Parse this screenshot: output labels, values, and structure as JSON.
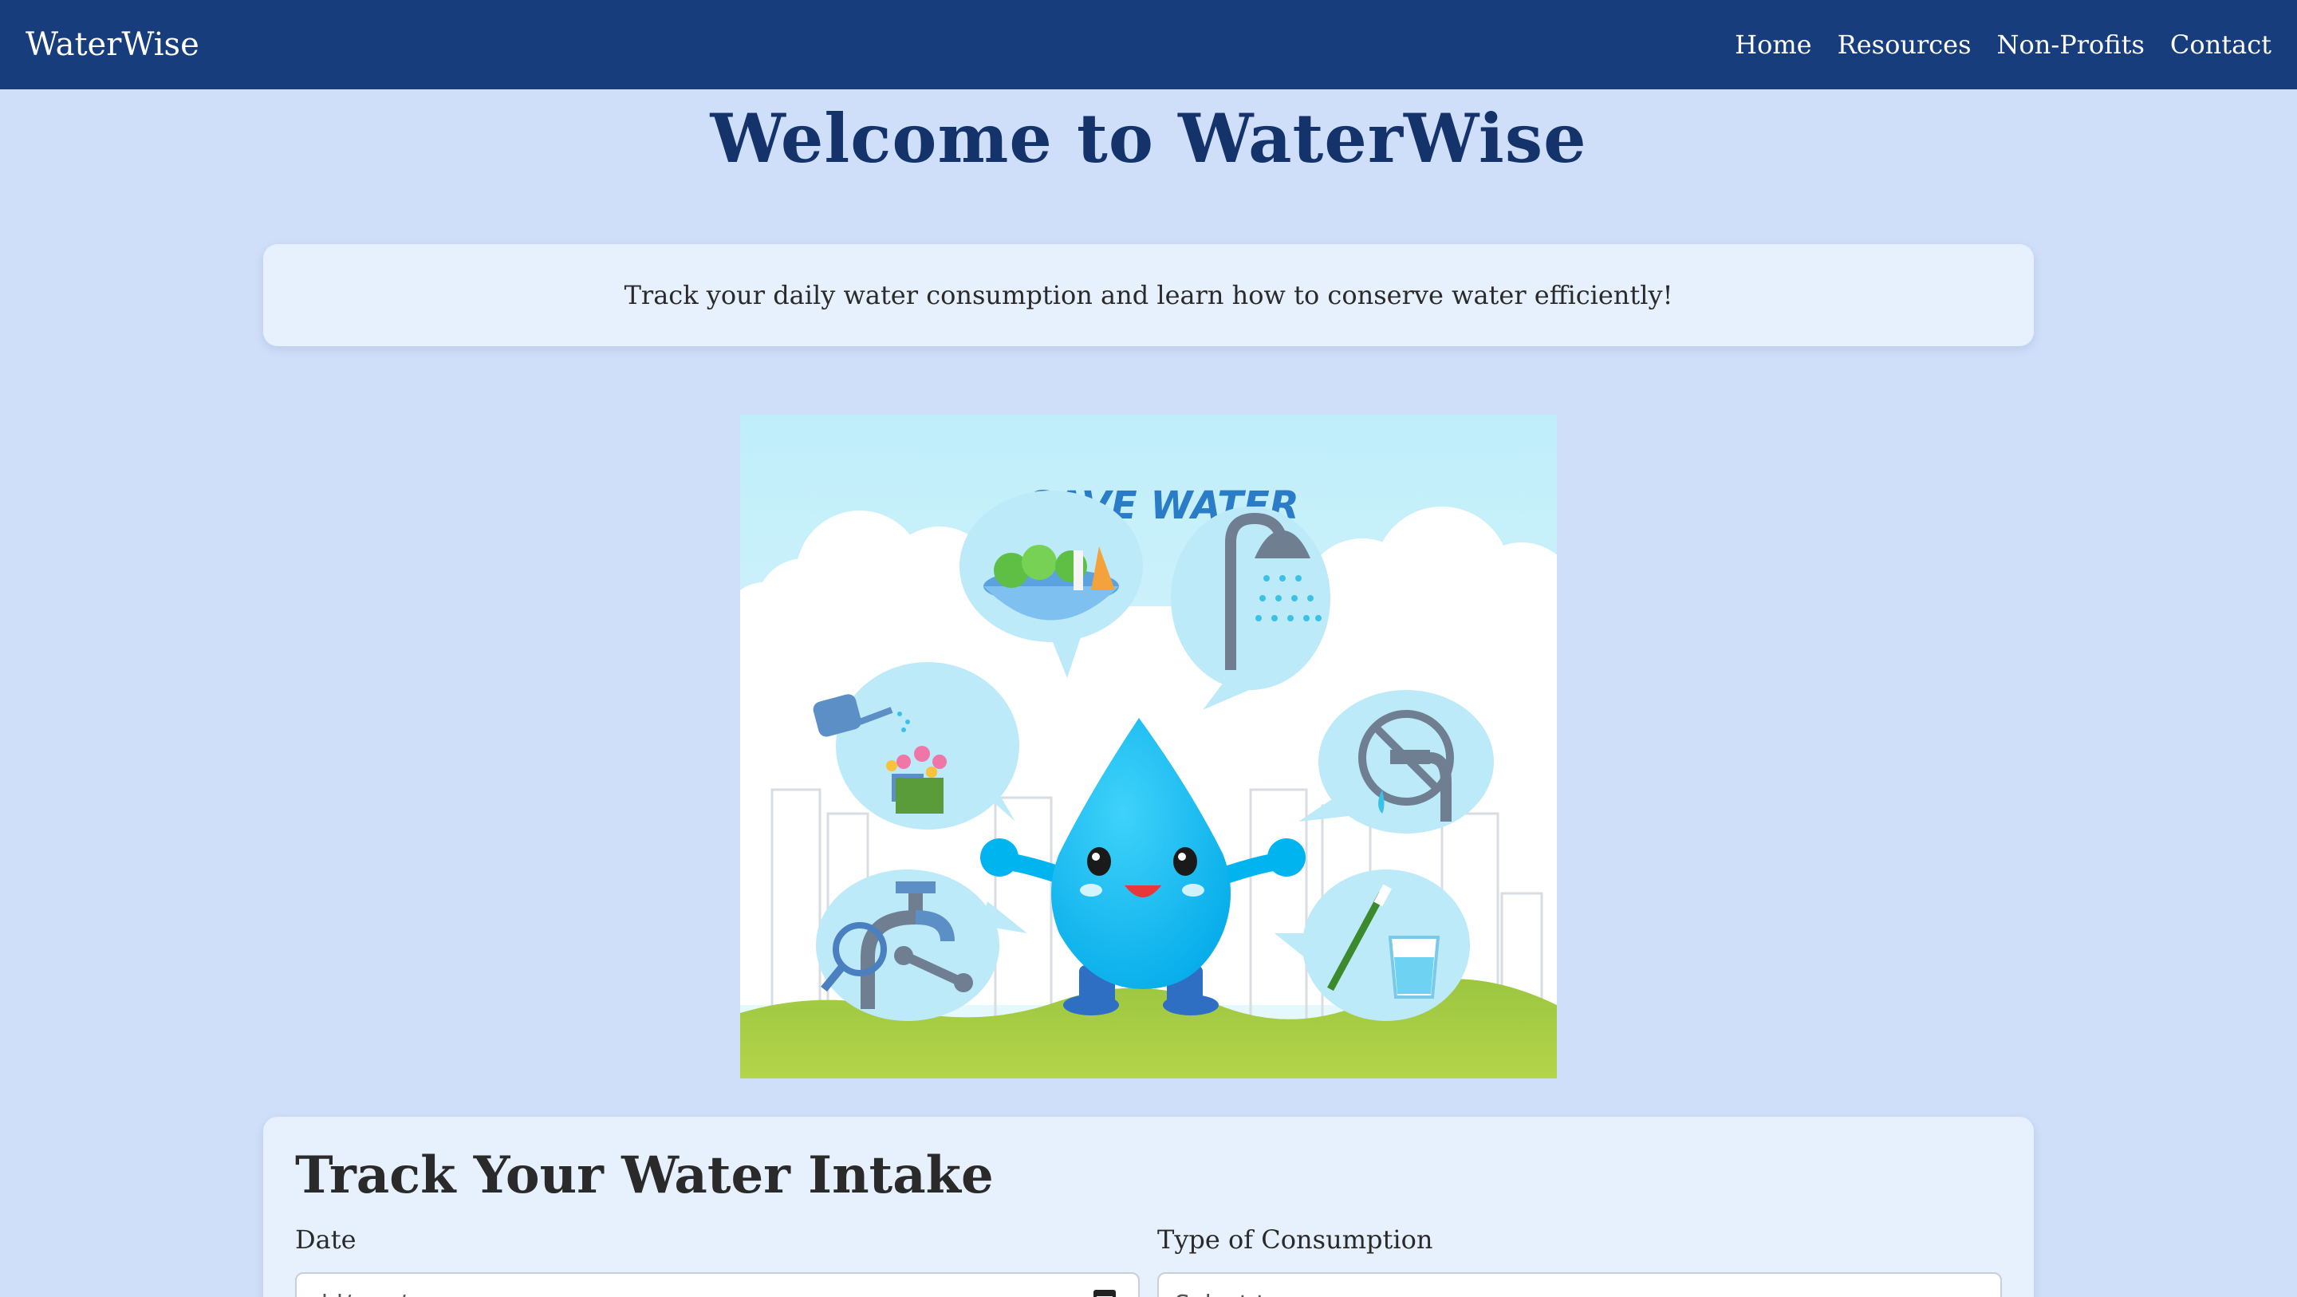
{
  "nav": {
    "brand": "WaterWise",
    "links": [
      "Home",
      "Resources",
      "Non-Profits",
      "Contact"
    ]
  },
  "hero": {
    "title": "Welcome to WaterWise"
  },
  "intro": {
    "text": "Track your daily water consumption and learn how to conserve water efficiently!"
  },
  "illustration": {
    "banner_text": "SAVE WATER"
  },
  "tracker": {
    "title": "Track Your Water Intake",
    "date_label": "Date",
    "date_placeholder": "dd/mm/yyyy",
    "type_label": "Type of Consumption",
    "type_placeholder": "Select type"
  },
  "colors": {
    "page_background": "#d0dff9",
    "navbar": "#183d7d",
    "heading": "#14336a",
    "card": "#e7f0fd"
  }
}
